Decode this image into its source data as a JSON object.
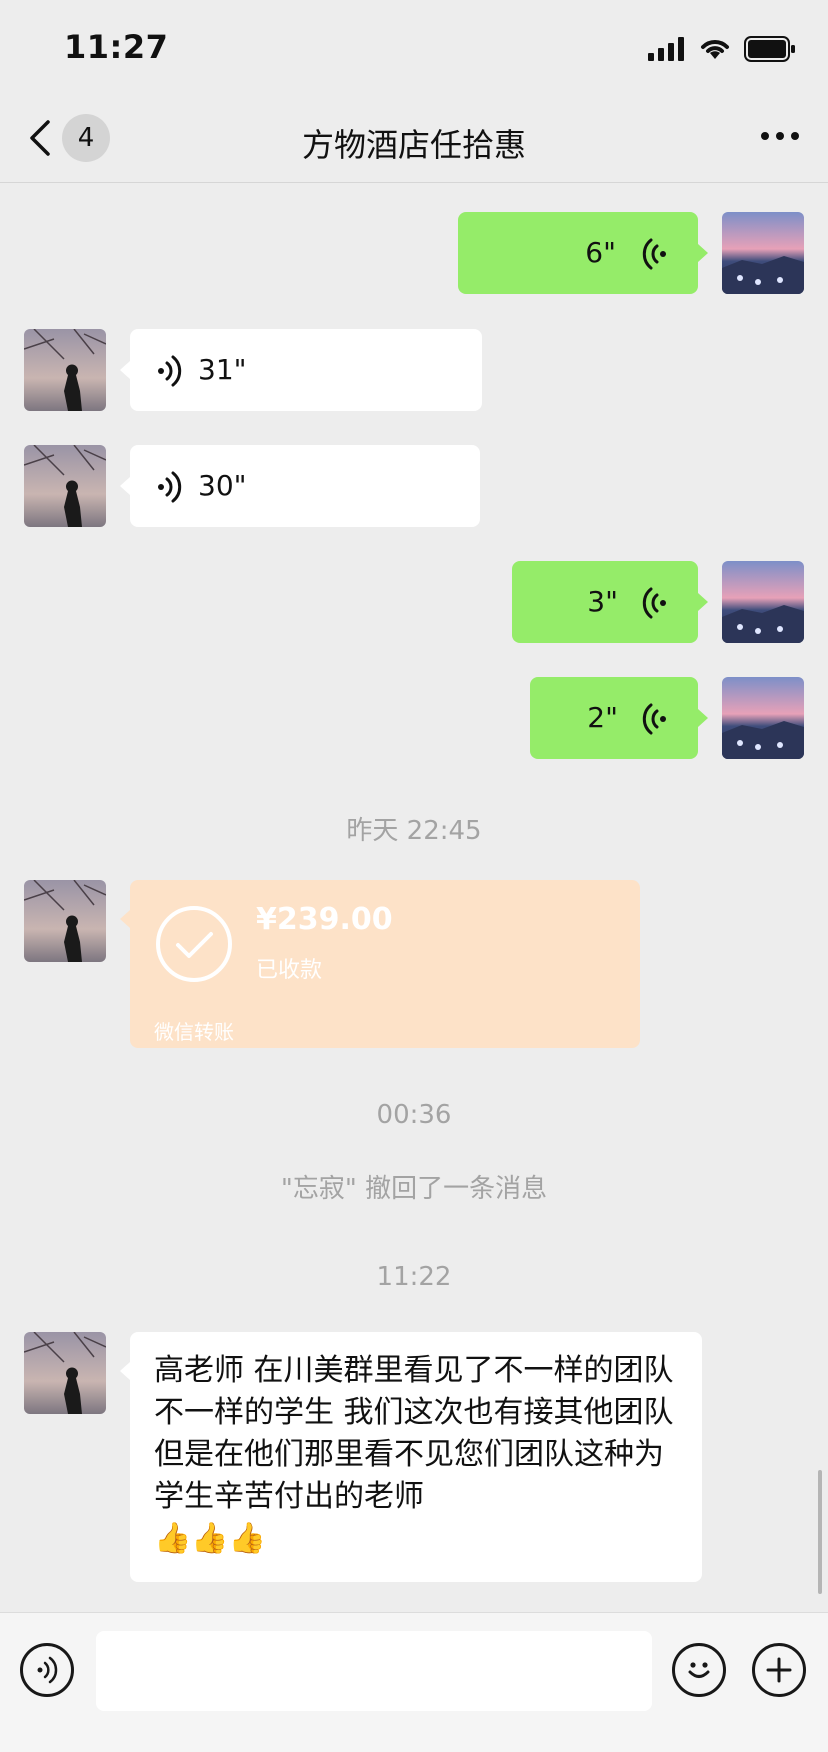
{
  "status_bar": {
    "time": "11:27"
  },
  "nav": {
    "unread_count": "4",
    "title": "方物酒店任拾惠"
  },
  "messages": [
    {
      "side": "right",
      "type": "voice",
      "duration": "6\""
    },
    {
      "side": "left",
      "type": "voice",
      "duration": "31\""
    },
    {
      "side": "left",
      "type": "voice",
      "duration": "30\""
    },
    {
      "side": "right",
      "type": "voice",
      "duration": "3\""
    },
    {
      "side": "right",
      "type": "voice",
      "duration": "2\""
    }
  ],
  "timestamps": {
    "t1": "昨天 22:45",
    "t2": "00:36",
    "t3": "11:22"
  },
  "transfer": {
    "amount": "¥239.00",
    "status": "已收款",
    "label": "微信转账"
  },
  "recall_notice": "\"忘寂\" 撤回了一条消息",
  "last_message": {
    "text": "高老师 在川美群里看见了不一样的团队 不一样的学生 我们这次也有接其他团队 但是在他们那里看不见您们团队这种为学生辛苦付出的老师",
    "emoji": "👍👍👍"
  },
  "colors": {
    "sent_bubble": "#95ec69",
    "received_bubble": "#ffffff",
    "transfer_bubble": "#fde2c8",
    "background": "#ededed"
  }
}
